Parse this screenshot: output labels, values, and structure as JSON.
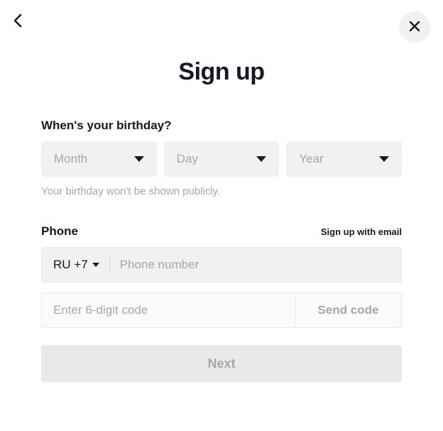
{
  "header": {
    "title": "Sign up"
  },
  "birthday": {
    "label": "When's your birthday?",
    "month_placeholder": "Month",
    "day_placeholder": "Day",
    "year_placeholder": "Year",
    "hint": "Your birthday won't be shown publicly."
  },
  "phone": {
    "label": "Phone",
    "email_link": "Sign up with email",
    "country_code": "RU +7",
    "placeholder": "Phone number"
  },
  "code": {
    "placeholder": "Enter 6-digit code",
    "send_label": "Send code"
  },
  "next_label": "Next"
}
